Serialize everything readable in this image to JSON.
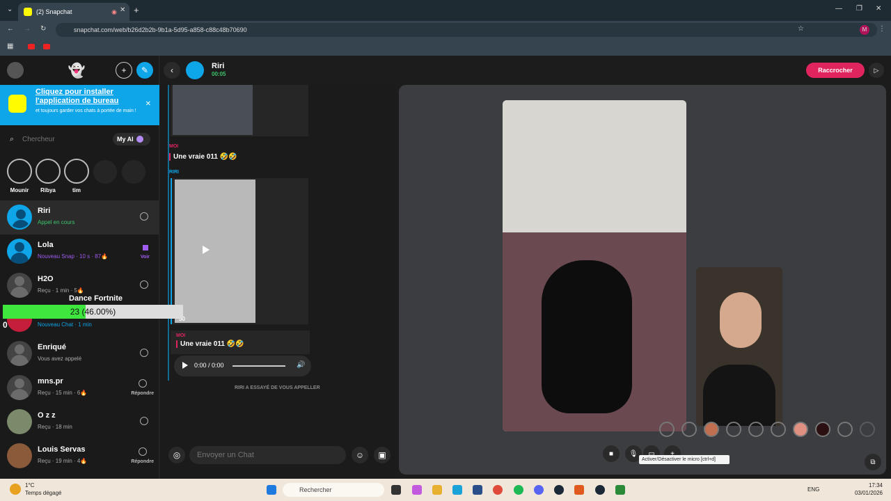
{
  "browser": {
    "tab_title": "(2) Snapchat",
    "url": "snapchat.com/web/b26d2b2b-9b1a-5d95-a858-c88c48b70690"
  },
  "sidebar": {
    "install_title": "Cliquez pour installer l'application de bureau",
    "install_sub": "et toujours garder vos chats à portée de main !",
    "search_placeholder": "Chercheur",
    "myai_label": "My AI",
    "stories": [
      {
        "name": "Mounir"
      },
      {
        "name": "Ribya"
      },
      {
        "name": "tim"
      }
    ],
    "chats": [
      {
        "name": "Riri",
        "status": "Appel en cours"
      },
      {
        "name": "Lola",
        "status": "Nouveau Snap · 10 s · 87🔥",
        "action": "Voir"
      },
      {
        "name": "H2O",
        "status": "Reçu · 1 min · 5🔥"
      },
      {
        "name": "",
        "status": "Nouveau Chat · 1 min"
      },
      {
        "name": "Enriqué",
        "status": "Vous avez appelé"
      },
      {
        "name": "mns.pr",
        "status": "Reçu · 15 min · 6🔥",
        "action": "Répondre"
      },
      {
        "name": "O z z",
        "status": "Reçu · 18 min"
      },
      {
        "name": "Louis Servas",
        "status": "Reçu · 19 min · 4🔥",
        "action": "Répondre"
      }
    ]
  },
  "chat": {
    "contact_name": "Riri",
    "call_timer": "00:05",
    "hangup_label": "Raccrocher",
    "label_me": "MOI",
    "label_riri": "RIRI",
    "msg1": "Une vraie 011 🤣🤣",
    "msg2": "Une vraie 011 🤣🤣",
    "view_count": "50",
    "audio_time": "0:00 / 0:00",
    "missed_call": "RIRI A ESSAYÉ DE VOUS APPELLER",
    "compose_placeholder": "Envoyer un Chat"
  },
  "video": {
    "tooltip": "Activer/Désactiver le micro [ctrl+d]"
  },
  "overlay": {
    "label": "Dance Fortnite",
    "value_text": "23 (46.00%)",
    "fraction": 0.46,
    "left_number": "0"
  },
  "taskbar": {
    "weather_temp": "1°C",
    "weather_desc": "Temps dégagé",
    "search_placeholder": "Rechercher",
    "lang": "ENG",
    "time": "17:34",
    "date": "03/01/2026"
  },
  "colors": {
    "snap_yellow": "#fffc00",
    "accent_blue": "#0ea5e9",
    "hangup_red": "#e0245e",
    "call_green": "#3ec46d"
  }
}
